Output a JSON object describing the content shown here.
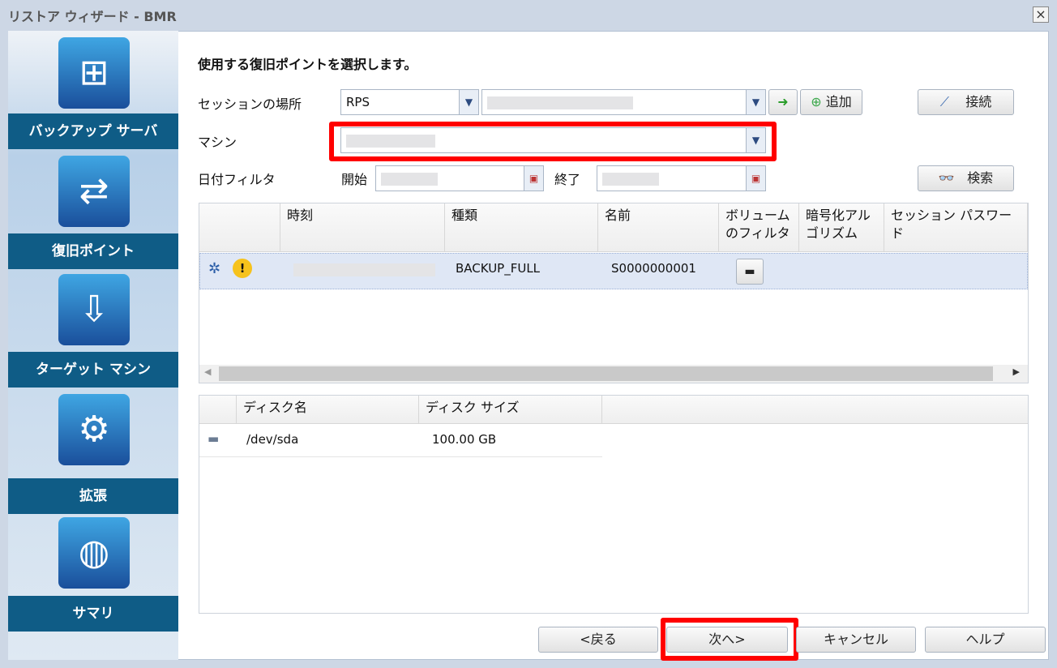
{
  "window": {
    "title": "リストア ウィザード - BMR",
    "close": "×"
  },
  "sidebar": {
    "steps": [
      {
        "label": "バックアップ サーバ",
        "icon": "server-network-icon"
      },
      {
        "label": "復旧ポイント",
        "icon": "arrows-exchange-icon"
      },
      {
        "label": "ターゲット マシン",
        "icon": "target-drive-icon"
      },
      {
        "label": "拡張",
        "icon": "gears-icon"
      },
      {
        "label": "サマリ",
        "icon": "globe-icon"
      }
    ]
  },
  "main": {
    "heading": "使用する復旧ポイントを選択します。",
    "session_label": "セッションの場所",
    "session_type": "RPS",
    "add_label": "追加",
    "connect_label": "接続",
    "machine_label": "マシン",
    "date_filter_label": "日付フィルタ",
    "start_label": "開始",
    "end_label": "終了",
    "search_label": "検索",
    "columns": [
      "時刻",
      "種類",
      "名前",
      "ボリューム のフィルタ",
      "暗号化アル ゴリズム",
      "セッション パスワー ド"
    ],
    "rows": [
      {
        "type": "BACKUP_FULL",
        "name": "S0000000001"
      }
    ],
    "disk_columns": [
      "ディスク名",
      "ディスク サイズ"
    ],
    "disks": [
      {
        "name": "/dev/sda",
        "size": "100.00 GB"
      }
    ]
  },
  "footer": {
    "back": "<戻る",
    "next": "次へ>",
    "cancel": "キャンセル",
    "help": "ヘルプ"
  }
}
